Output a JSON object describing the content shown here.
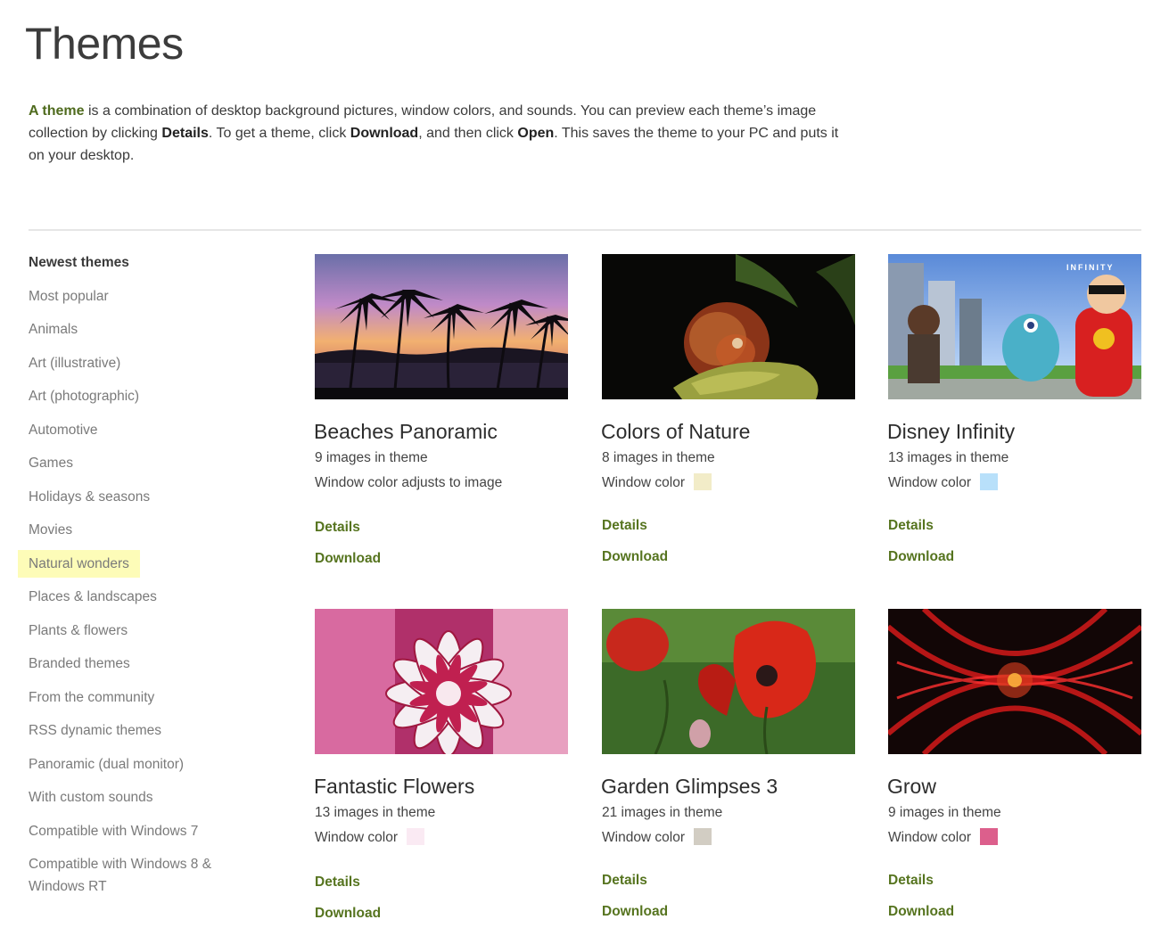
{
  "page": {
    "title": "Themes",
    "intro": {
      "link_text": "A theme",
      "text_1": " is a combination of desktop background pictures, window colors, and sounds. You can preview each theme’s image collection by clicking ",
      "bold_1": "Details",
      "text_2": ". To get a theme, click ",
      "bold_2": "Download",
      "text_3": ", and then click ",
      "bold_3": "Open",
      "text_4": ". This saves the theme to your PC and puts it on your desktop."
    }
  },
  "sidebar": {
    "items": [
      {
        "label": "Newest themes"
      },
      {
        "label": "Most popular"
      },
      {
        "label": "Animals"
      },
      {
        "label": "Art (illustrative)"
      },
      {
        "label": "Art (photographic)"
      },
      {
        "label": "Automotive"
      },
      {
        "label": "Games"
      },
      {
        "label": "Holidays & seasons"
      },
      {
        "label": "Movies"
      },
      {
        "label": "Natural wonders"
      },
      {
        "label": "Places & landscapes"
      },
      {
        "label": "Plants & flowers"
      },
      {
        "label": "Branded themes"
      },
      {
        "label": "From the community"
      },
      {
        "label": "RSS dynamic themes"
      },
      {
        "label": "Panoramic (dual monitor)"
      },
      {
        "label": "With custom sounds"
      },
      {
        "label": "Compatible with Windows 7"
      },
      {
        "label": "Compatible with Windows 8 & Windows RT"
      }
    ],
    "active_index": 0,
    "highlight_index": 9
  },
  "themes": [
    {
      "title": "Beaches Panoramic",
      "count": "9 images in theme",
      "color_label": "Window color adjusts to image",
      "swatch": "",
      "details": "Details",
      "download": "Download"
    },
    {
      "title": "Colors of Nature",
      "count": "8 images in theme",
      "color_label": "Window color",
      "swatch": "#f2ecc8",
      "details": "Details",
      "download": "Download"
    },
    {
      "title": "Disney Infinity",
      "count": "13 images in theme",
      "color_label": "Window color",
      "swatch": "#b8e0fa",
      "details": "Details",
      "download": "Download"
    },
    {
      "title": "Fantastic Flowers",
      "count": "13 images in theme",
      "color_label": "Window color",
      "swatch": "#faeaf3",
      "details": "Details",
      "download": "Download"
    },
    {
      "title": "Garden Glimpses 3",
      "count": "21 images in theme",
      "color_label": "Window color",
      "swatch": "#d2cdc3",
      "details": "Details",
      "download": "Download"
    },
    {
      "title": "Grow",
      "count": "9 images in theme",
      "color_label": "Window color",
      "swatch": "#dc5f8c",
      "details": "Details",
      "download": "Download"
    }
  ],
  "thumb_images": {
    "disney_logo_text": "INFINITY"
  },
  "colors": {
    "link_green": "#56741f",
    "highlight": "#fdfcb8"
  }
}
